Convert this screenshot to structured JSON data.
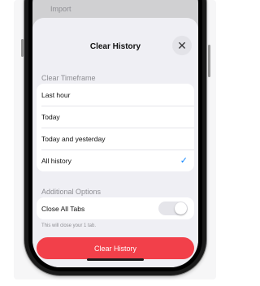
{
  "background": {
    "behind_text": "Import"
  },
  "sheet": {
    "title": "Clear History",
    "close_icon": "xmark-icon"
  },
  "timeframe": {
    "label": "Clear Timeframe",
    "options": [
      {
        "label": "Last hour",
        "selected": false
      },
      {
        "label": "Today",
        "selected": false
      },
      {
        "label": "Today and yesterday",
        "selected": false
      },
      {
        "label": "All history",
        "selected": true
      }
    ],
    "check_glyph": "✓"
  },
  "additional": {
    "label": "Additional Options",
    "close_tabs_label": "Close All Tabs",
    "close_tabs_on": false,
    "hint": "This will close your 1 tab."
  },
  "action": {
    "label": "Clear History",
    "color": "#f2404a"
  },
  "colors": {
    "accent": "#0a84ff",
    "destructive": "#f2404a"
  }
}
